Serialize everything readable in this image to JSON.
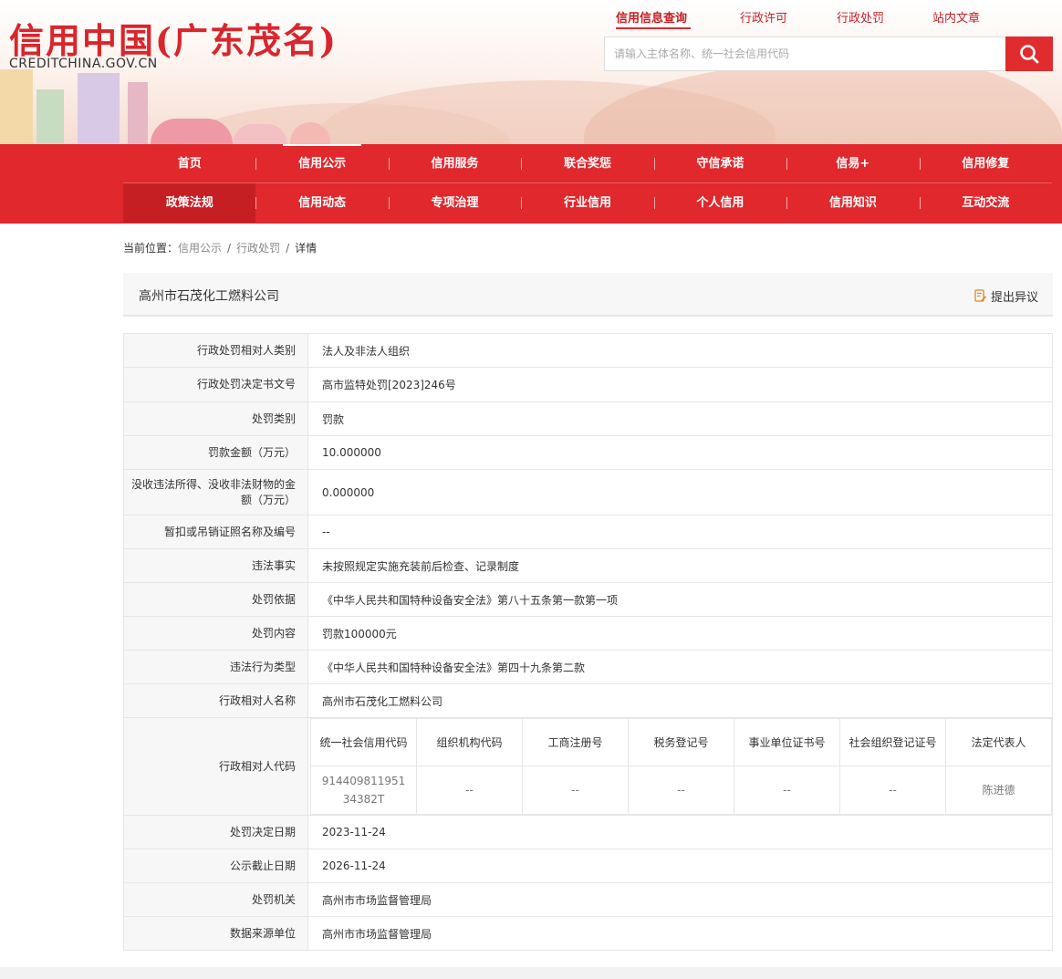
{
  "header": {
    "logo_cn": "信用中国(广东茂名)",
    "logo_en": "CREDITCHINA.GOV.CN",
    "top_links": [
      "信用信息查询",
      "行政许可",
      "行政处罚",
      "站内文章"
    ],
    "search_placeholder": "请输入主体名称、统一社会信用代码"
  },
  "nav": {
    "row1": [
      "首页",
      "信用公示",
      "信用服务",
      "联合奖惩",
      "守信承诺",
      "信易+",
      "信用修复"
    ],
    "row2": [
      "政策法规",
      "信用动态",
      "专项治理",
      "行业信用",
      "个人信用",
      "信用知识",
      "互动交流"
    ]
  },
  "breadcrumb": {
    "prefix": "当前位置：",
    "items": [
      "信用公示",
      "行政处罚"
    ],
    "current": "详情",
    "sep": "/"
  },
  "title": "高州市石茂化工燃料公司",
  "objection_label": "提出异议",
  "rows": [
    {
      "label": "行政处罚相对人类别",
      "value": "法人及非法人组织"
    },
    {
      "label": "行政处罚决定书文号",
      "value": "高市监特处罚[2023]246号"
    },
    {
      "label": "处罚类别",
      "value": "罚款"
    },
    {
      "label": "罚款金额（万元）",
      "value": "10.000000"
    },
    {
      "label": "没收违法所得、没收非法财物的金额（万元）",
      "value": "0.000000"
    },
    {
      "label": "暂扣或吊销证照名称及编号",
      "value": "--"
    },
    {
      "label": "违法事实",
      "value": "未按照规定实施充装前后检查、记录制度"
    },
    {
      "label": "处罚依据",
      "value": "《中华人民共和国特种设备安全法》第八十五条第一款第一项"
    },
    {
      "label": "处罚内容",
      "value": "罚款100000元"
    },
    {
      "label": "违法行为类型",
      "value": "《中华人民共和国特种设备安全法》第四十九条第二款"
    },
    {
      "label": "行政相对人名称",
      "value": "高州市石茂化工燃料公司"
    }
  ],
  "code_row": {
    "label": "行政相对人代码",
    "headers": [
      "统一社会信用代码",
      "组织机构代码",
      "工商注册号",
      "税务登记号",
      "事业单位证书号",
      "社会组织登记证号",
      "法定代表人"
    ],
    "values": [
      "91440981195134382T",
      "--",
      "--",
      "--",
      "--",
      "--",
      "陈进德"
    ]
  },
  "rows_after": [
    {
      "label": "处罚决定日期",
      "value": "2023-11-24"
    },
    {
      "label": "公示截止日期",
      "value": "2026-11-24"
    },
    {
      "label": "处罚机关",
      "value": "高州市市场监督管理局"
    },
    {
      "label": "数据来源单位",
      "value": "高州市市场监督管理局"
    }
  ],
  "colors": {
    "brand_red": "#e0282d",
    "active_red": "#c51f24"
  },
  "icons": {
    "search": "search-icon",
    "objection": "edit-document-icon"
  }
}
